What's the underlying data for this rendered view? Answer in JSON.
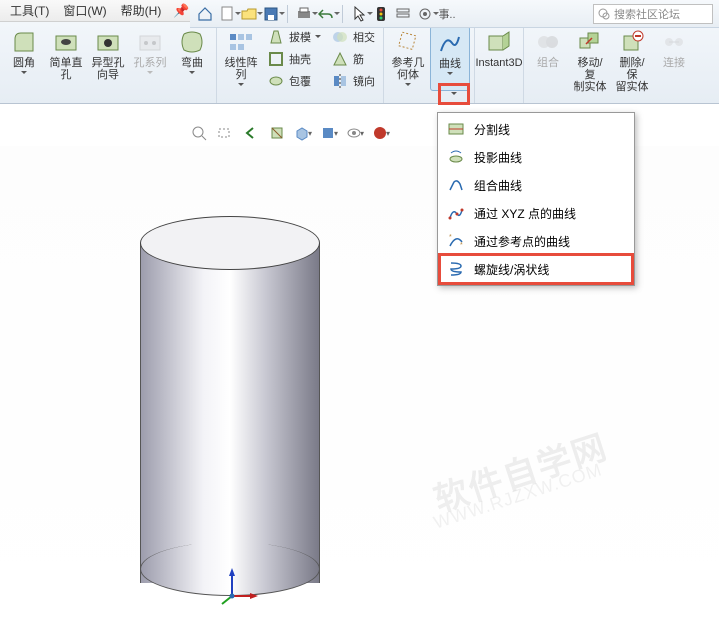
{
  "menubar": {
    "items": [
      "工具(T)",
      "窗口(W)",
      "帮助(H)"
    ],
    "search_placeholder": "搜索社区论坛"
  },
  "ribbon": {
    "g1": {
      "fillet": "圆角",
      "chamfer_hole": "简单直\n孔",
      "wizard_hole": "异型孔\n向导",
      "hole_series": "孔系列",
      "wrap": "弯曲"
    },
    "g2": {
      "linear_pattern": "线性阵\n列",
      "draft": "拔模",
      "intersect": "相交",
      "shell": "抽壳",
      "rib": "筋",
      "wrap2": "包覆",
      "mirror": "镜向"
    },
    "g3": {
      "ref_geom": "参考几\n何体",
      "curves": "曲线"
    },
    "g4": {
      "instant3d": "Instant3D"
    },
    "g5": {
      "combine": "组合",
      "move_copy": "移动/复\n制实体",
      "delete_keep": "删除/保\n留实体",
      "connect": "连接"
    }
  },
  "curve_menu": {
    "items": [
      {
        "label": "分割线"
      },
      {
        "label": "投影曲线"
      },
      {
        "label": "组合曲线"
      },
      {
        "label": "通过 XYZ 点的曲线"
      },
      {
        "label": "通过参考点的曲线"
      },
      {
        "label": "螺旋线/涡状线",
        "highlight": true
      }
    ]
  },
  "watermark": {
    "main": "软件自学网",
    "sub": "WWW.RJZXW.COM"
  }
}
